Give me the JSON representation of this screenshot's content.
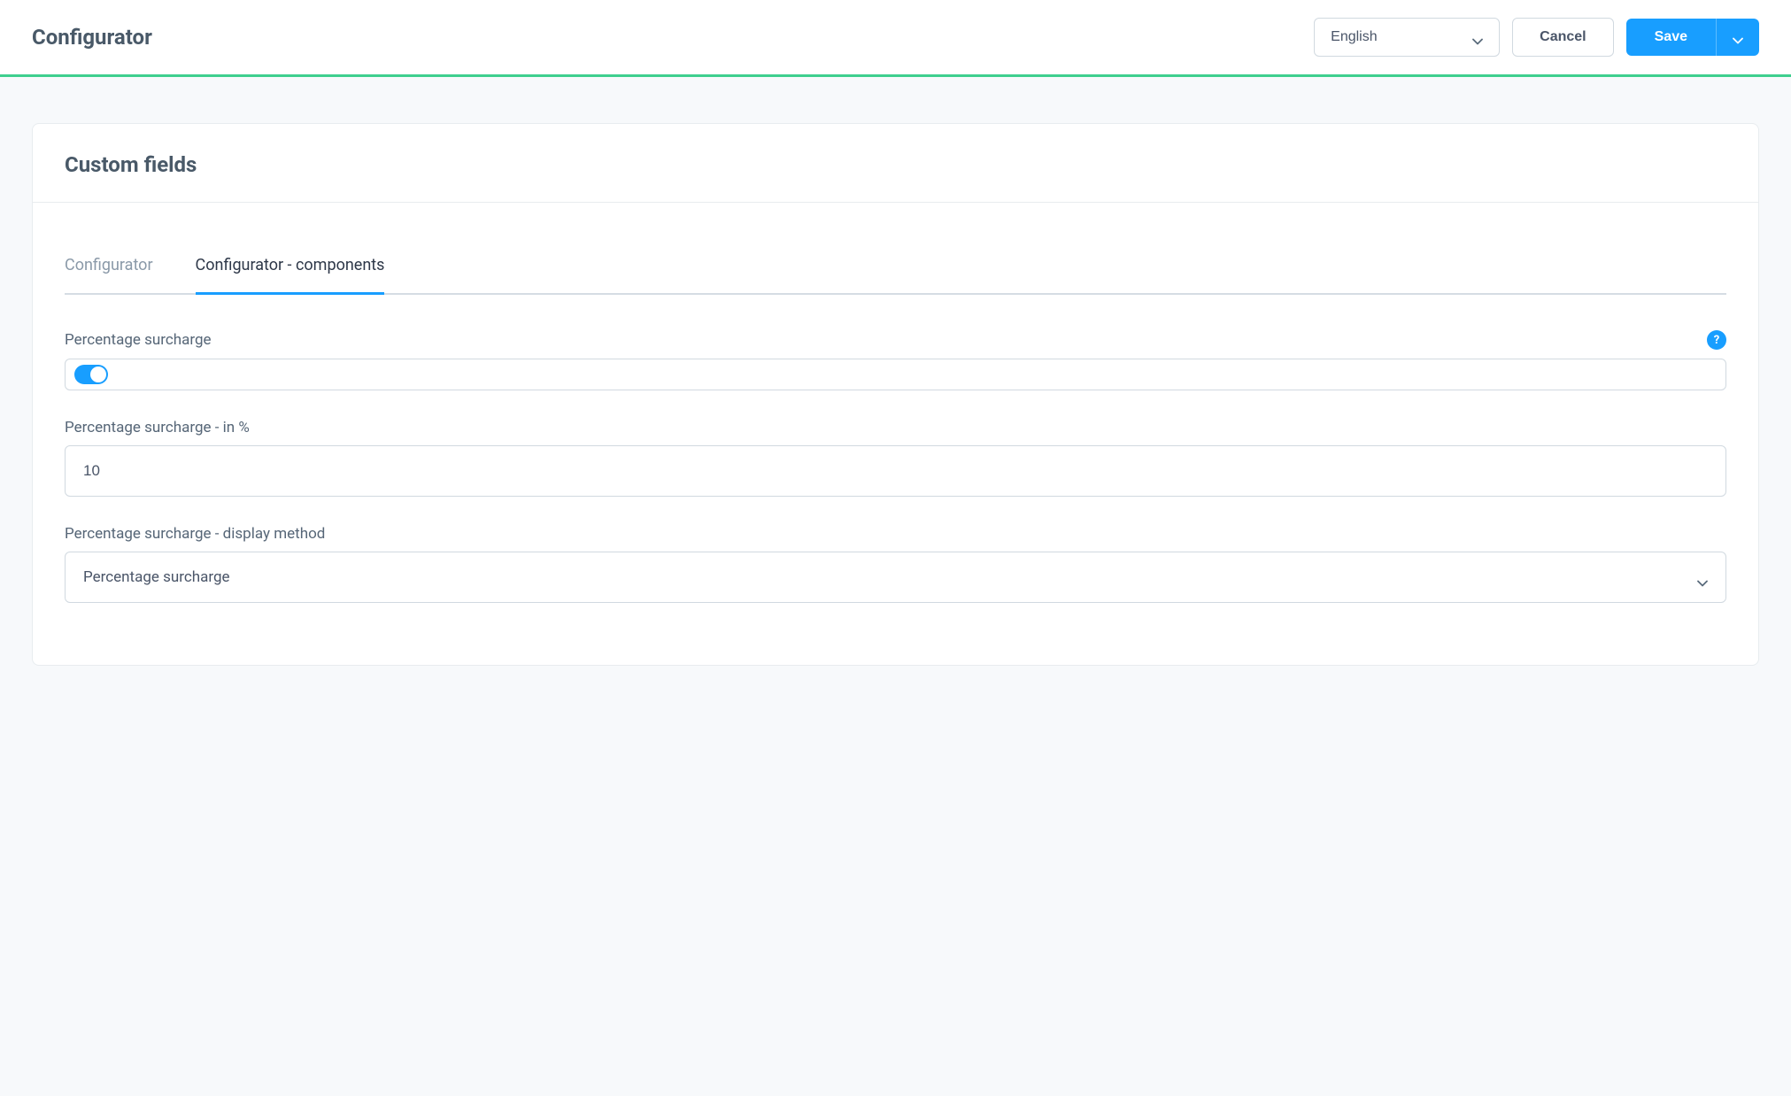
{
  "header": {
    "title": "Configurator",
    "language": "English",
    "cancel_label": "Cancel",
    "save_label": "Save"
  },
  "card": {
    "title": "Custom fields"
  },
  "tabs": [
    {
      "label": "Configurator",
      "active": false
    },
    {
      "label": "Configurator - components",
      "active": true
    }
  ],
  "fields": {
    "percentage_surcharge": {
      "label": "Percentage surcharge",
      "enabled": true
    },
    "percentage_surcharge_value": {
      "label": "Percentage surcharge - in %",
      "value": "10"
    },
    "percentage_surcharge_display": {
      "label": "Percentage surcharge - display method",
      "value": "Percentage surcharge"
    }
  }
}
